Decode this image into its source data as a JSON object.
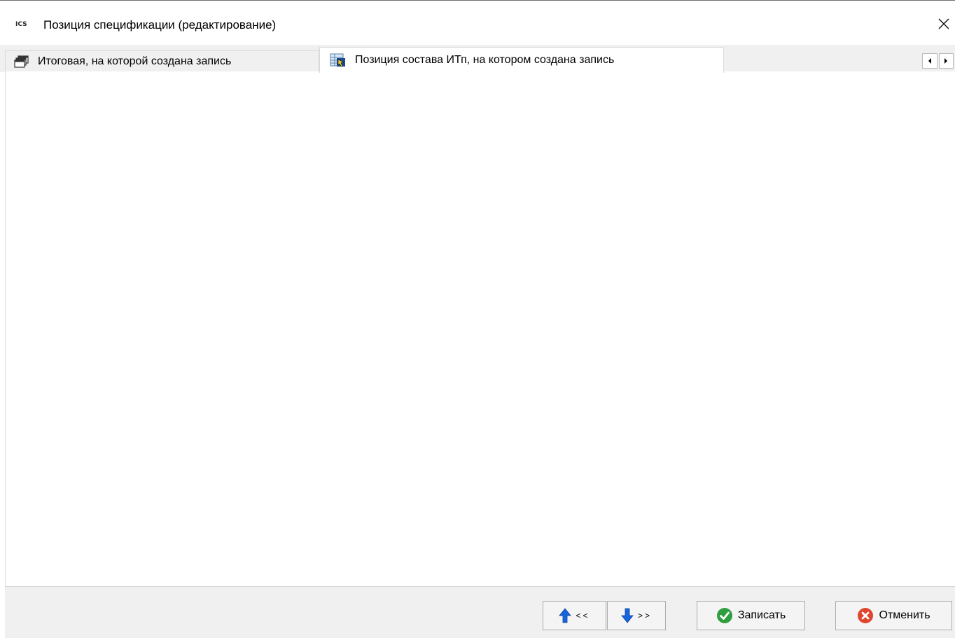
{
  "window": {
    "app_icon_text": "ICS",
    "title": "Позиция спецификации (редактирование)",
    "close_glyph": "✕"
  },
  "tabs": [
    {
      "label": "Итоговая, на которой создана запись",
      "icon": "windows-stack-icon",
      "active": false
    },
    {
      "label": "Позиция состава ИТп, на котором создана запись",
      "icon": "table-cursor-icon",
      "active": true
    }
  ],
  "tab_scroll": {
    "left_glyph": "◂",
    "right_glyph": "▸"
  },
  "footer": {
    "prev_label": "<<",
    "next_label": ">>",
    "save_label": "Записать",
    "cancel_label": "Отменить"
  },
  "colors": {
    "save_icon": "#2e9e3f",
    "cancel_icon": "#e0452f",
    "arrow_blue": "#1565e0"
  }
}
